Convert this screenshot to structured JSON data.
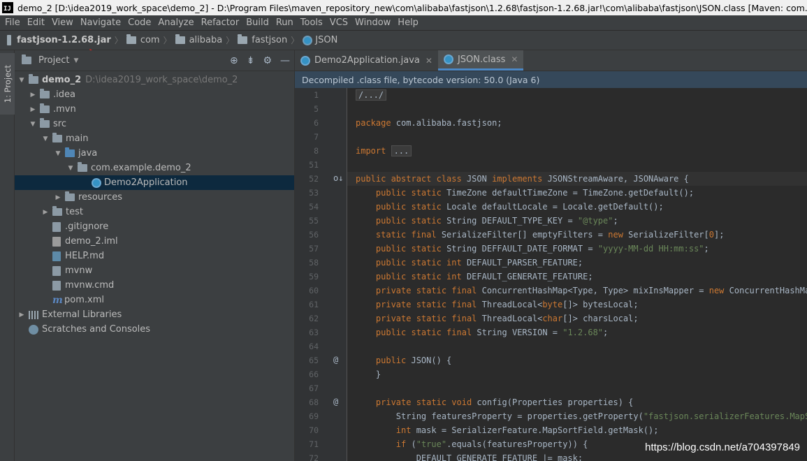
{
  "window": {
    "title": "demo_2 [D:\\idea2019_work_space\\demo_2] - D:\\Program Files\\maven_repository_new\\com\\alibaba\\fastjson\\1.2.68\\fastjson-1.2.68.jar!\\com\\alibaba\\fastjson\\JSON.class [Maven: com.alibaba:fastjs",
    "logo": "IJ"
  },
  "menu": [
    "File",
    "Edit",
    "View",
    "Navigate",
    "Code",
    "Analyze",
    "Refactor",
    "Build",
    "Run",
    "Tools",
    "VCS",
    "Window",
    "Help"
  ],
  "breadcrumb": {
    "jar": "fastjson-1.2.68.jar",
    "com": "com",
    "alibaba": "alibaba",
    "fastjson": "fastjson",
    "cls": "JSON"
  },
  "stripe": {
    "label": "1: Project"
  },
  "project": {
    "title": "Project",
    "tree": {
      "root": "demo_2",
      "root_path": "D:\\idea2019_work_space\\demo_2",
      "idea": ".idea",
      "mvn": ".mvn",
      "src": "src",
      "main": "main",
      "java": "java",
      "pkg": "com.example.demo_2",
      "app": "Demo2Application",
      "resources": "resources",
      "test": "test",
      "gitignore": ".gitignore",
      "iml": "demo_2.iml",
      "help": "HELP.md",
      "mvnw": "mvnw",
      "mvnwcmd": "mvnw.cmd",
      "pom": "pom.xml",
      "libs": "External Libraries",
      "scratches": "Scratches and Consoles"
    }
  },
  "editor": {
    "tabs": [
      {
        "label": "Demo2Application.java"
      },
      {
        "label": "JSON.class"
      }
    ],
    "banner": "Decompiled .class file, bytecode version: 50.0 (Java 6)",
    "line_numbers": [
      "1",
      "5",
      "6",
      "7",
      "8",
      "51",
      "52",
      "53",
      "54",
      "55",
      "56",
      "57",
      "58",
      "59",
      "60",
      "61",
      "62",
      "63",
      "64",
      "65",
      "66",
      "67",
      "68",
      "69",
      "70",
      "71",
      "72"
    ],
    "gutter_marks": {
      "52": "o↓",
      "65": "@",
      "68": "@"
    }
  },
  "watermark": "https://blog.csdn.net/a704397849",
  "colors": {
    "keyword": "#cc7832",
    "string": "#6a8759",
    "comment": "#808080",
    "text": "#a9b7c6",
    "annotation_arrow": "#e0201c"
  }
}
